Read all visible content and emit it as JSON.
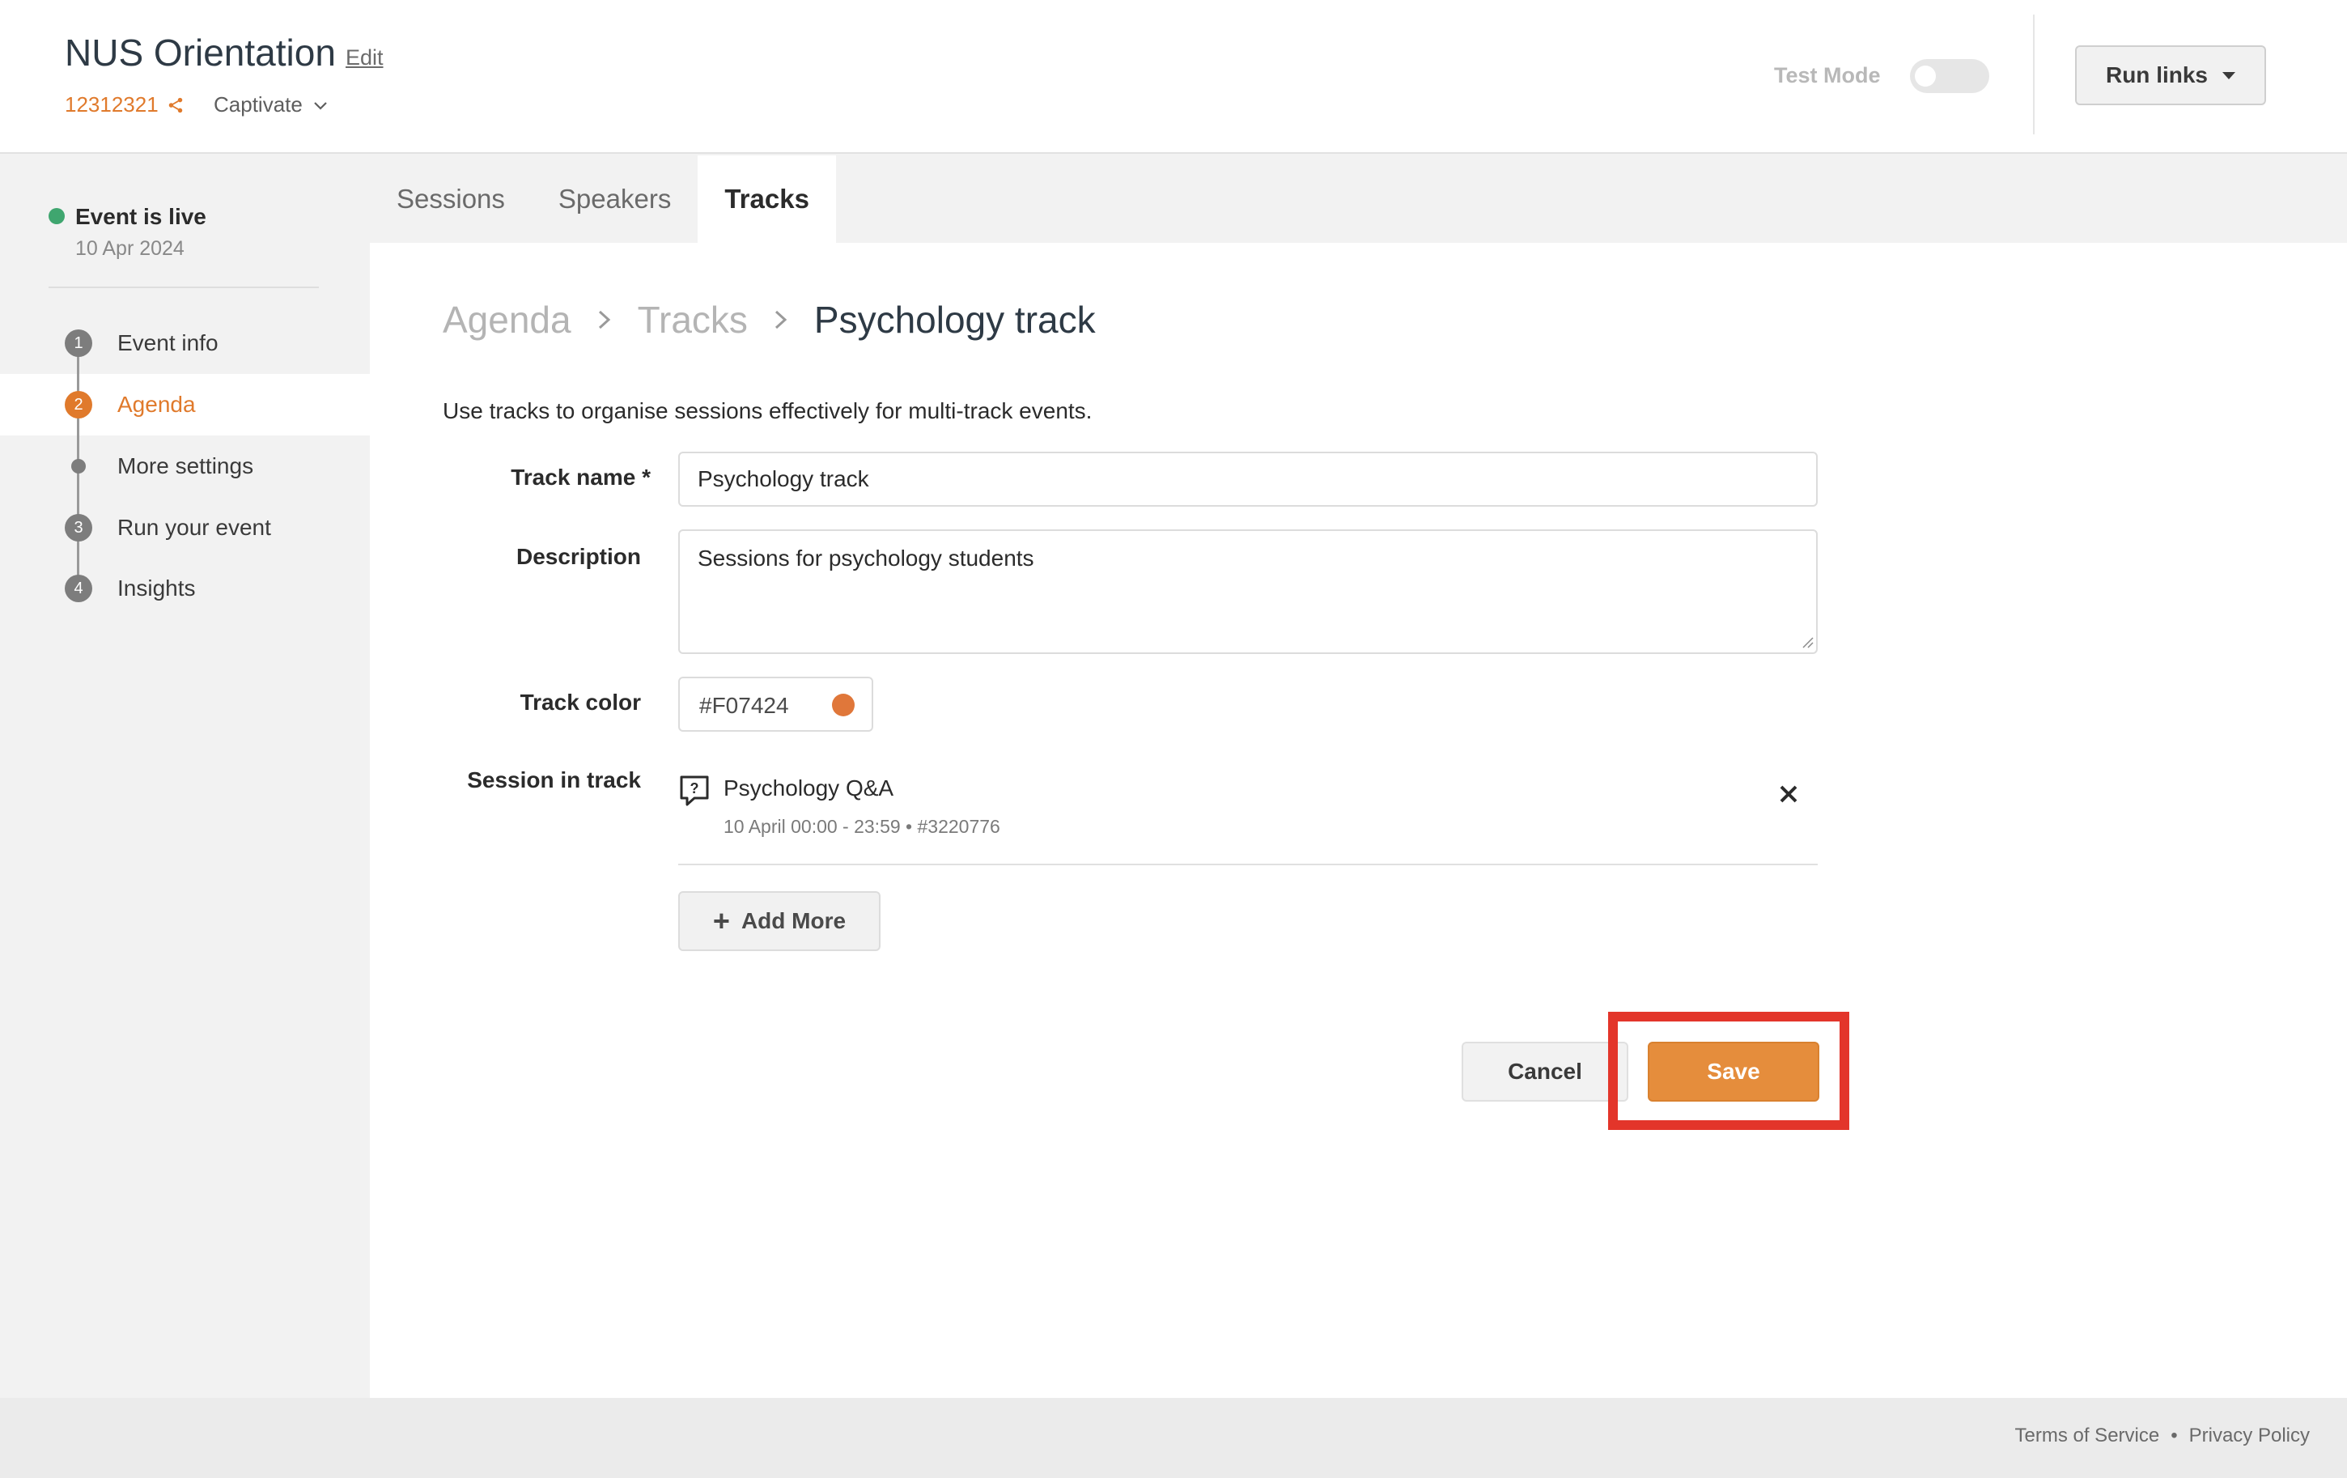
{
  "header": {
    "event_title": "NUS Orientation",
    "edit_label": "Edit",
    "event_code": "12312321",
    "org_name": "Captivate",
    "test_mode_label": "Test Mode",
    "test_mode_on": false,
    "run_links_label": "Run links"
  },
  "sidebar": {
    "status_label": "Event is live",
    "status_date": "10 Apr 2024",
    "status_color": "#3fa66f",
    "steps": [
      {
        "number": "1",
        "label": "Event info",
        "active": false
      },
      {
        "number": "2",
        "label": "Agenda",
        "active": true
      },
      {
        "number": "",
        "label": "More settings",
        "active": false
      },
      {
        "number": "3",
        "label": "Run your event",
        "active": false
      },
      {
        "number": "4",
        "label": "Insights",
        "active": false
      }
    ]
  },
  "tabs": [
    {
      "label": "Sessions",
      "active": false
    },
    {
      "label": "Speakers",
      "active": false
    },
    {
      "label": "Tracks",
      "active": true
    }
  ],
  "breadcrumb": [
    "Agenda",
    "Tracks",
    "Psychology track"
  ],
  "intro_text": "Use tracks to organise sessions effectively for multi-track events.",
  "form": {
    "track_name_label": "Track name *",
    "track_name_value": "Psychology track",
    "description_label": "Description",
    "description_value": "Sessions for psychology students",
    "track_color_label": "Track color",
    "track_color_value": "#F07424",
    "track_color_swatch": "#e0773a",
    "session_in_track_label": "Session in track",
    "sessions": [
      {
        "name": "Psychology Q&A",
        "meta": "10 April 00:00 - 23:59 • #3220776",
        "icon": "question-bubble-icon"
      }
    ],
    "add_more_label": "Add More",
    "cancel_label": "Cancel",
    "save_label": "Save"
  },
  "footer": {
    "terms_label": "Terms of Service",
    "separator": "•",
    "privacy_label": "Privacy Policy"
  },
  "colors": {
    "accent": "#e07a2c",
    "save_button": "#e58d3c",
    "highlight": "#e3352a"
  }
}
